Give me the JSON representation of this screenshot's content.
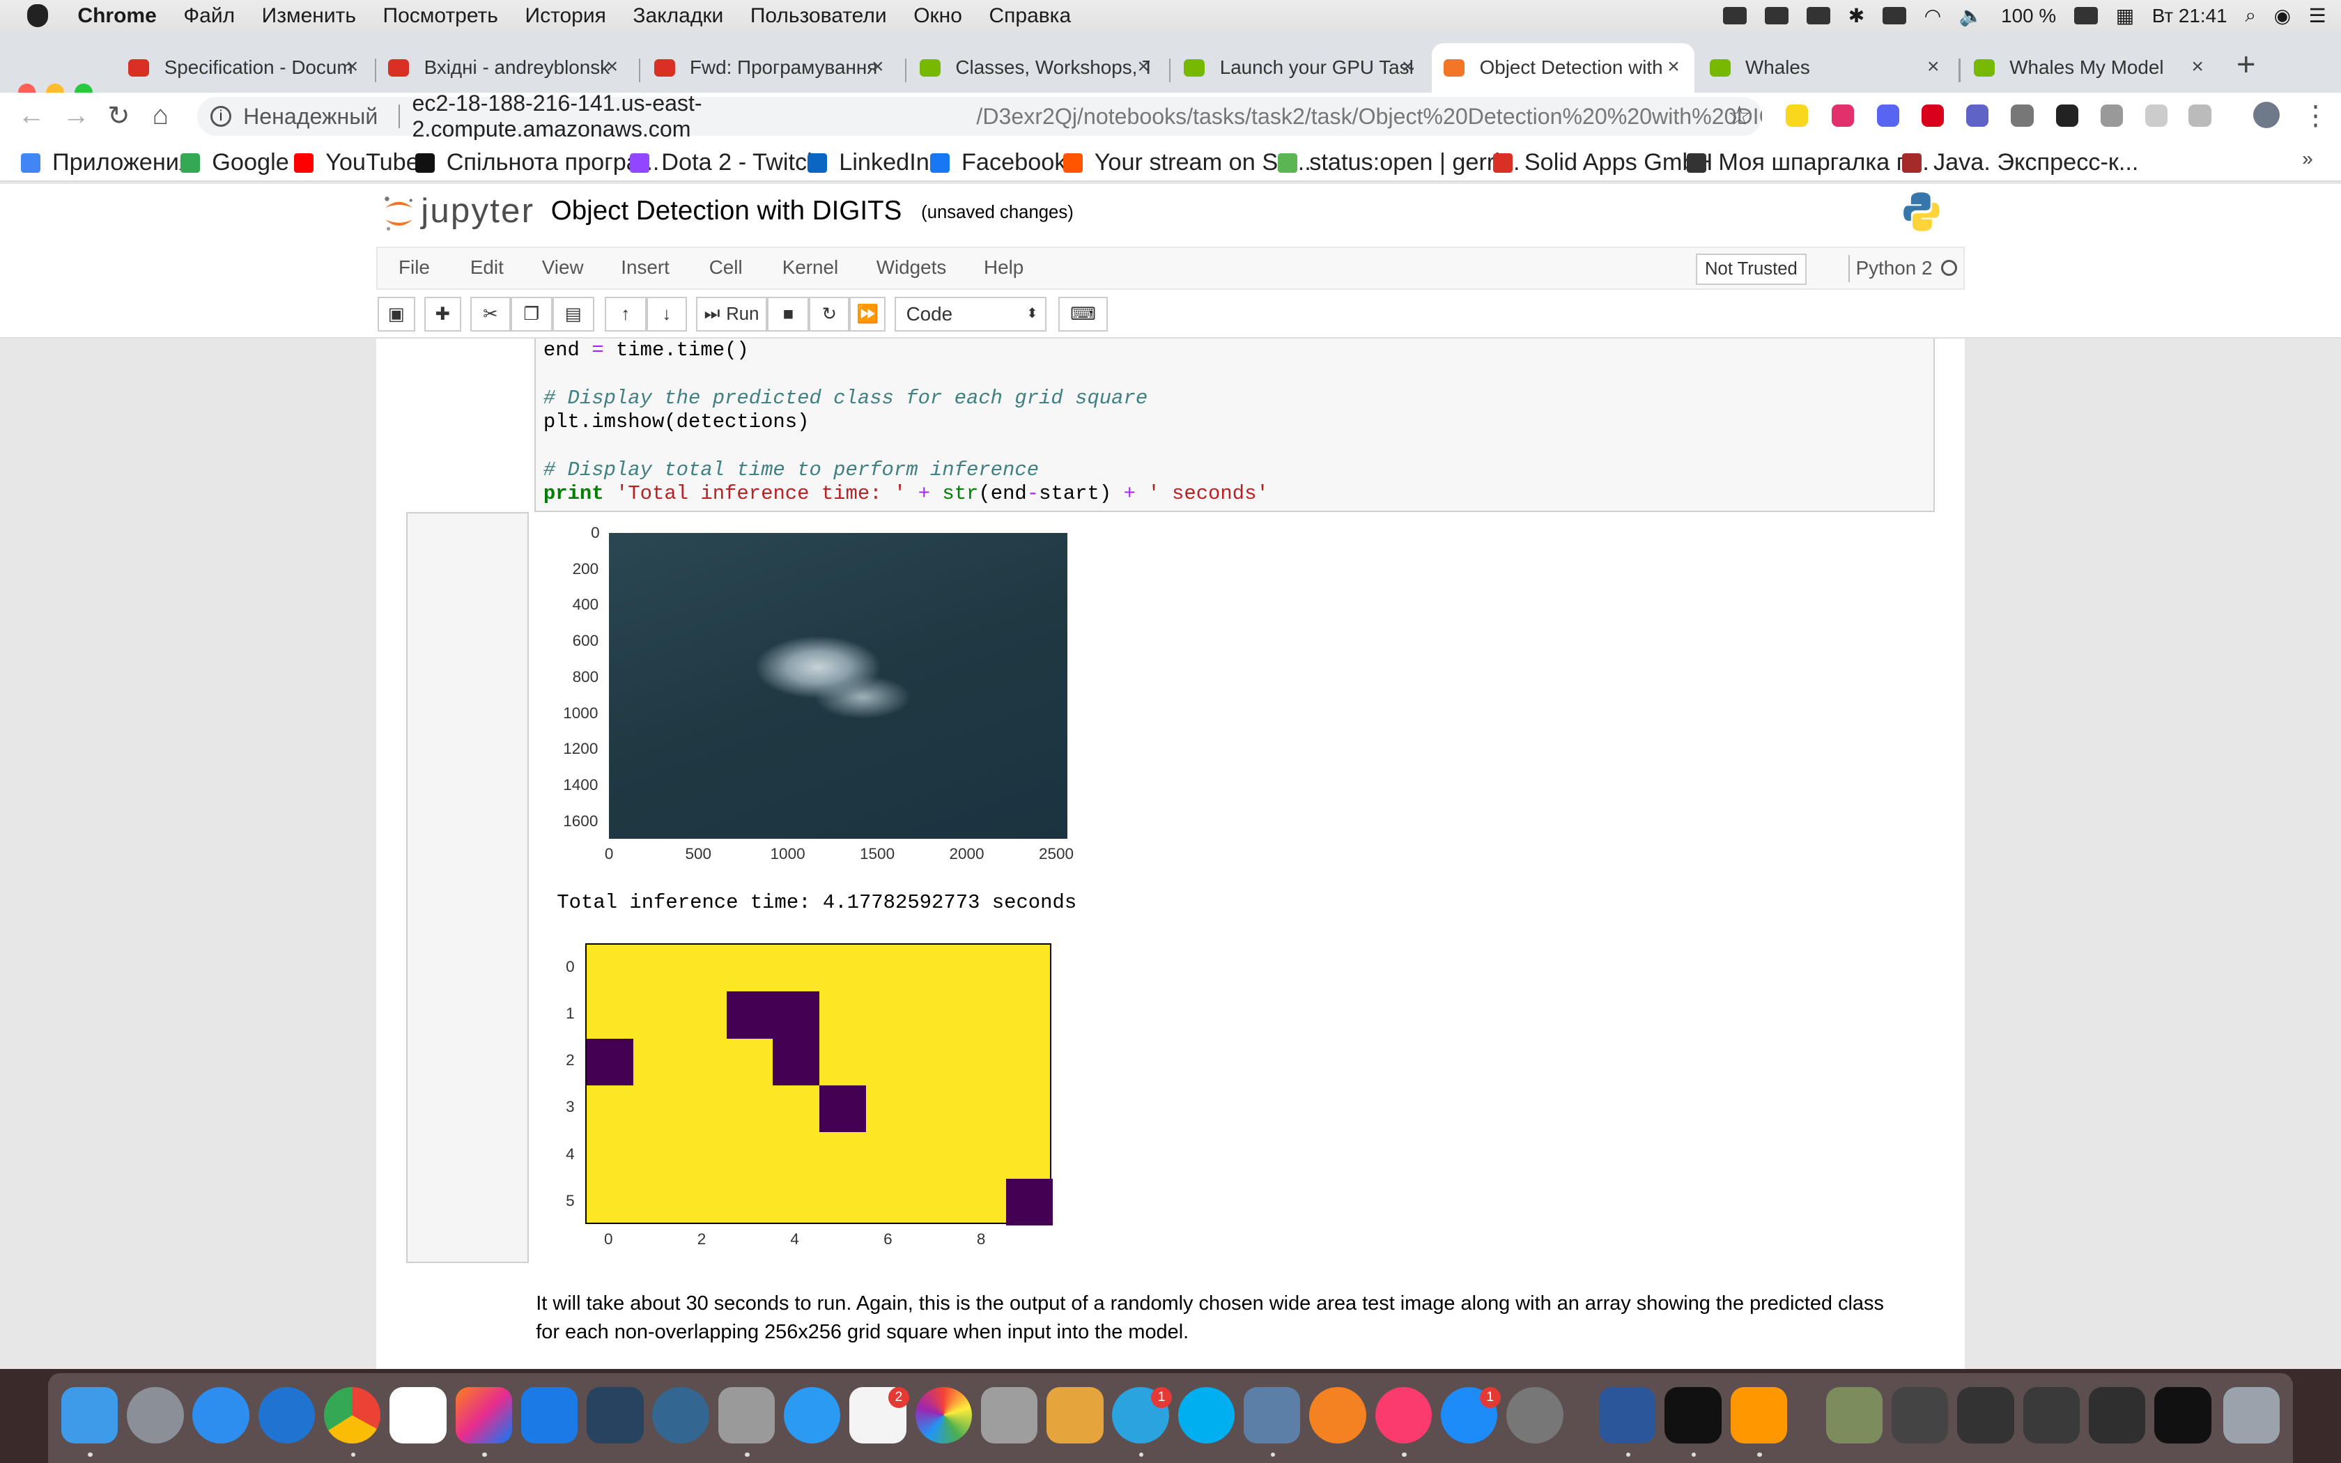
{
  "menubar": {
    "app": "Chrome",
    "items": [
      "Файл",
      "Изменить",
      "Посмотреть",
      "История",
      "Закладки",
      "Пользователи",
      "Окно",
      "Справка"
    ],
    "battery": "100 %",
    "clock": "Вт 21:41"
  },
  "tabs": [
    {
      "title": "Specification - Docum",
      "color": "#d93025"
    },
    {
      "title": "Вхідні - andreyblonsk",
      "color": "#d93025"
    },
    {
      "title": "Fwd: Програмування",
      "color": "#d93025"
    },
    {
      "title": "Classes, Workshops, T",
      "color": "#76b900"
    },
    {
      "title": "Launch your GPU Task",
      "color": "#76b900"
    },
    {
      "title": "Object Detection with",
      "color": "#f37626"
    },
    {
      "title": "Whales",
      "color": "#76b900"
    },
    {
      "title": "Whales My Model",
      "color": "#76b900"
    }
  ],
  "omnibox": {
    "security": "Ненадежный",
    "host": "ec2-18-188-216-141.us-east-2.compute.amazonaws.com",
    "path": "/D3exr2Qj/notebooks/tasks/task2/task/Object%20Detection%20%20with%20DIGITS.ip..."
  },
  "bookmarks": [
    "Приложения",
    "Google",
    "YouTube",
    "Спільнота програ...",
    "Dota 2 - Twitch",
    "LinkedIn",
    "Facebook",
    "Your stream on So...",
    "status:open | gerri...",
    "Solid Apps GmbH",
    "Моя шпаргалка п...",
    "Java. Экспресс-к..."
  ],
  "jupyter": {
    "logo_text": "jupyter",
    "title": "Object Detection with DIGITS",
    "saved": "(unsaved changes)",
    "menu": [
      "File",
      "Edit",
      "View",
      "Insert",
      "Cell",
      "Kernel",
      "Widgets",
      "Help"
    ],
    "trust": "Not Trusted",
    "kernel": "Python 2",
    "run_label": "Run",
    "cell_type": "Code"
  },
  "code": {
    "l1a": "end",
    "l1b": "=",
    "l1c": "time.time()",
    "c1": "# Display the predicted class for each grid square",
    "l2": "plt.imshow(detections)",
    "c2": "# Display total time to perform inference",
    "p_kw": "print",
    "p_s1": "'Total inference time: '",
    "p_op1": "+",
    "p_fn": "str",
    "p_arg": "(end",
    "p_op2": "-",
    "p_arg2": "start)",
    "p_op3": "+",
    "p_s2": "' seconds'"
  },
  "output": {
    "image_x_ticks": [
      "0",
      "500",
      "1000",
      "1500",
      "2000",
      "2500"
    ],
    "image_y_ticks": [
      "0",
      "200",
      "400",
      "600",
      "800",
      "1000",
      "1200",
      "1400",
      "1600"
    ],
    "inference_text": "Total inference time: 4.17782592773 seconds",
    "grid_x_ticks": [
      "0",
      "2",
      "4",
      "6",
      "8"
    ],
    "grid_y_ticks": [
      "0",
      "1",
      "2",
      "3",
      "4",
      "5"
    ],
    "grid_cols": 10,
    "grid_rows": 6,
    "detections": [
      [
        1,
        3
      ],
      [
        1,
        4
      ],
      [
        2,
        0
      ],
      [
        2,
        4
      ],
      [
        3,
        5
      ],
      [
        5,
        9
      ]
    ],
    "colors": {
      "background": "#fde725",
      "detection": "#440154"
    }
  },
  "paragraph": "It will take about 30 seconds to run. Again, this is the output of a randomly chosen wide area test image along with an array showing the predicted class for each non-overlapping 256x256 grid square when input into the model.",
  "dock_badges": [
    "2",
    "1",
    "1"
  ]
}
